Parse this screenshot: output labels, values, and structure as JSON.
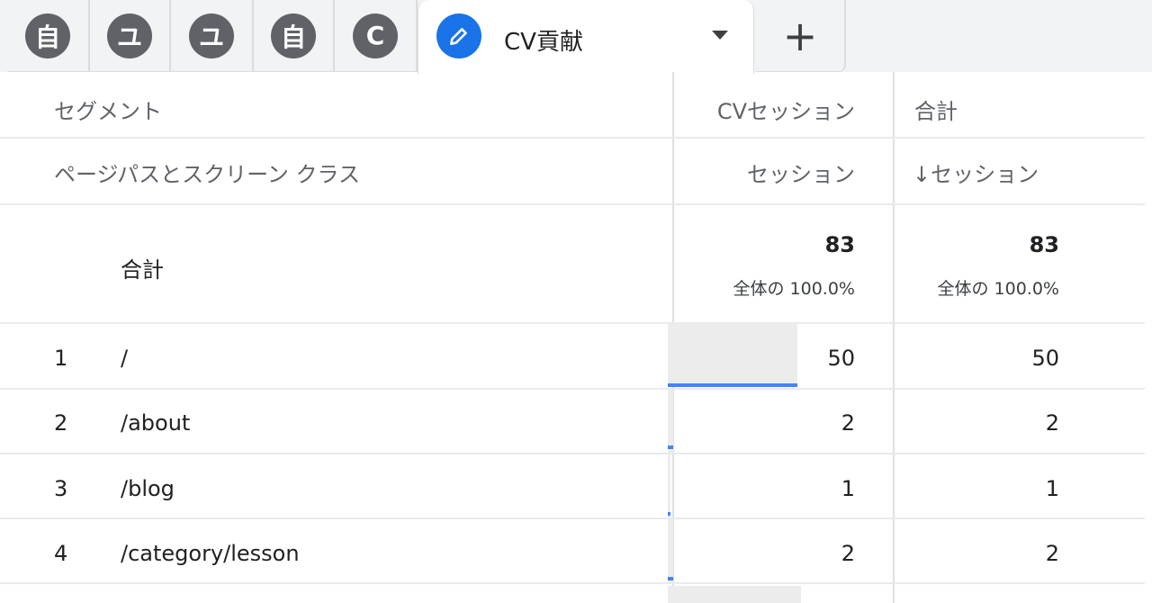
{
  "tabs": {
    "small": [
      {
        "glyph": "自"
      },
      {
        "glyph": "ユ"
      },
      {
        "glyph": "ユ"
      },
      {
        "glyph": "自"
      },
      {
        "glyph": "C"
      }
    ],
    "active": {
      "label": "CV貢献"
    },
    "add_label": "+"
  },
  "table": {
    "header1": {
      "dimension": "セグメント",
      "col1": "CVセッション",
      "col2": "合計"
    },
    "header2": {
      "dimension": "ページパスとスクリーン クラス",
      "col1": "セッション",
      "col2": "↓セッション"
    },
    "total": {
      "label": "合計",
      "col1_value": "83",
      "col1_pct": "全体の 100.0%",
      "col2_value": "83",
      "col2_pct": "全体の 100.0%"
    },
    "rows": [
      {
        "index": "1",
        "path": "/",
        "col1": "50",
        "col2": "50",
        "bar_fraction": 0.602
      },
      {
        "index": "2",
        "path": "/about",
        "col1": "2",
        "col2": "2",
        "bar_fraction": 0.024
      },
      {
        "index": "3",
        "path": "/blog",
        "col1": "1",
        "col2": "1",
        "bar_fraction": 0.012
      },
      {
        "index": "4",
        "path": "/category/lesson",
        "col1": "2",
        "col2": "2",
        "bar_fraction": 0.024
      }
    ]
  },
  "colors": {
    "accent": "#1a73e8",
    "bar": "#4285f4",
    "icon_bg": "#5f6368"
  }
}
